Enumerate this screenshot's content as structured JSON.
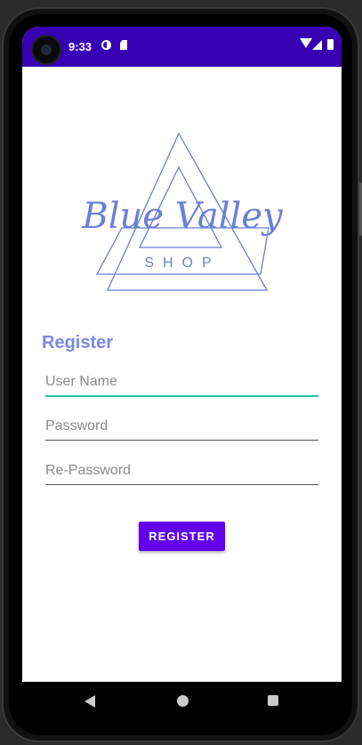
{
  "status_bar": {
    "time": "9:33"
  },
  "logo": {
    "script_text": "Blue Valley",
    "sub_text": "SHOP",
    "color": "#6a7fd6"
  },
  "form": {
    "title": "Register",
    "username_placeholder": "User Name",
    "password_placeholder": "Password",
    "repassword_placeholder": "Re-Password",
    "register_label": "REGISTER"
  },
  "colors": {
    "accent": "#6200ee",
    "status_bar": "#3700b3",
    "title": "#7a86e8",
    "focus_line": "#20c997"
  }
}
